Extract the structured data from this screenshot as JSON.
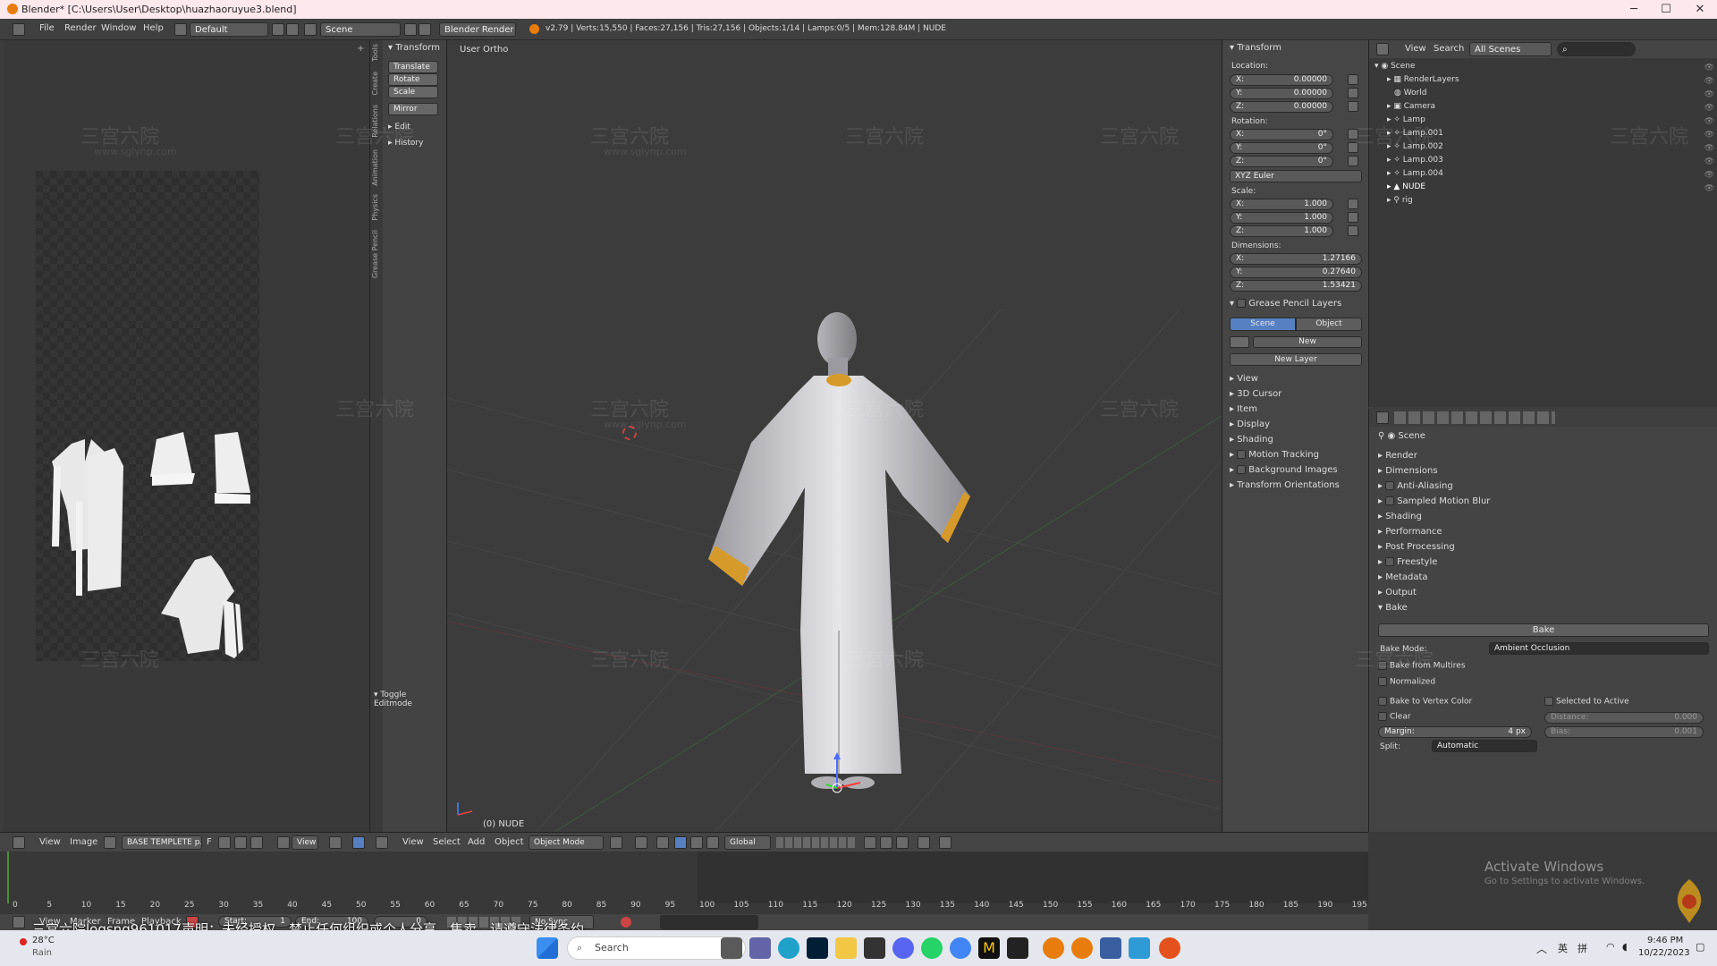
{
  "window": {
    "title": "Blender* [C:\\Users\\User\\Desktop\\huazhaoruyue3.blend]",
    "minimize": "─",
    "maximize": "☐",
    "close": "✕"
  },
  "menu": {
    "file": "File",
    "render": "Render",
    "window": "Window",
    "help": "Help",
    "layout": "Default",
    "scene": "Scene",
    "engine": "Blender Render",
    "stats": "v2.79 | Verts:15,550 | Faces:27,156 | Tris:27,156 | Objects:1/14 | Lamps:0/5 | Mem:128.84M | NUDE"
  },
  "toolshelf": {
    "header": "Transform",
    "translate": "Translate",
    "rotate": "Rotate",
    "scale": "Scale",
    "mirror": "Mirror",
    "edit": "Edit",
    "history": "History",
    "toggle": "Toggle Editmode",
    "tabs": [
      "Tools",
      "Create",
      "Relations",
      "Animation",
      "Physics",
      "Grease Pencil"
    ]
  },
  "viewport": {
    "label": "User Ortho",
    "object_label": "(0) NUDE",
    "watermark_cn": "三宫六院",
    "watermark_url": "www.sglynp.com"
  },
  "npanel": {
    "transform": "Transform",
    "location": "Location:",
    "rotation": "Rotation:",
    "scale": "Scale:",
    "dimensions": "Dimensions:",
    "loc": [
      {
        "k": "X:",
        "v": "0.00000"
      },
      {
        "k": "Y:",
        "v": "0.00000"
      },
      {
        "k": "Z:",
        "v": "0.00000"
      }
    ],
    "rot": [
      {
        "k": "X:",
        "v": "0°"
      },
      {
        "k": "Y:",
        "v": "0°"
      },
      {
        "k": "Z:",
        "v": "0°"
      }
    ],
    "euler": "XYZ Euler",
    "scl": [
      {
        "k": "X:",
        "v": "1.000"
      },
      {
        "k": "Y:",
        "v": "1.000"
      },
      {
        "k": "Z:",
        "v": "1.000"
      }
    ],
    "dim": [
      {
        "k": "X:",
        "v": "1.27166"
      },
      {
        "k": "Y:",
        "v": "0.27640"
      },
      {
        "k": "Z:",
        "v": "1.53421"
      }
    ],
    "gp_layers": "Grease Pencil Layers",
    "gp_scene": "Scene",
    "gp_object": "Object",
    "gp_new": "New",
    "gp_newlayer": "New Layer",
    "sections": [
      "View",
      "3D Cursor",
      "Item",
      "Display",
      "Shading",
      "Motion Tracking",
      "Background Images",
      "Transform Orientations"
    ]
  },
  "outliner": {
    "view": "View",
    "search": "Search",
    "filter": "All Scenes",
    "items": [
      {
        "name": "Scene",
        "indent": 0
      },
      {
        "name": "RenderLayers",
        "indent": 1
      },
      {
        "name": "World",
        "indent": 1
      },
      {
        "name": "Camera",
        "indent": 1
      },
      {
        "name": "Lamp",
        "indent": 1
      },
      {
        "name": "Lamp.001",
        "indent": 1
      },
      {
        "name": "Lamp.002",
        "indent": 1
      },
      {
        "name": "Lamp.003",
        "indent": 1
      },
      {
        "name": "Lamp.004",
        "indent": 1
      },
      {
        "name": "NUDE",
        "indent": 1
      },
      {
        "name": "rig",
        "indent": 1
      }
    ]
  },
  "props": {
    "scene": "Scene",
    "sections": [
      "Render",
      "Dimensions",
      "Anti-Aliasing",
      "Sampled Motion Blur",
      "Shading",
      "Performance",
      "Post Processing",
      "Freestyle",
      "Metadata",
      "Output",
      "Bake"
    ],
    "bake_btn": "Bake",
    "bake_mode_label": "Bake Mode:",
    "bake_mode": "Ambient Occlusion",
    "from_multires": "Bake from Multires",
    "normalized": "Normalized",
    "vertex_color": "Bake to Vertex Color",
    "selected_active": "Selected to Active",
    "clear": "Clear",
    "distance": "Distance:",
    "distance_v": "0.000",
    "margin": "Margin:",
    "margin_v": "4 px",
    "bias": "Bias:",
    "bias_v": "0.001",
    "split": "Split:",
    "split_v": "Automatic"
  },
  "vheader": {
    "view": "View",
    "image": "Image",
    "image_name": "BASE TEMPLETE p...",
    "f": "F",
    "view2": "View",
    "view3": "View",
    "select": "Select",
    "add": "Add",
    "object": "Object",
    "mode": "Object Mode",
    "orientation": "Global"
  },
  "timeline": {
    "ticks": [
      "0",
      "5",
      "10",
      "15",
      "20",
      "25",
      "30",
      "35",
      "40",
      "45",
      "50",
      "55",
      "60",
      "65",
      "70",
      "75",
      "80",
      "85",
      "90",
      "95",
      "100",
      "105",
      "110",
      "115",
      "120",
      "125",
      "130",
      "135",
      "140",
      "145",
      "150",
      "155",
      "160",
      "165",
      "170",
      "175",
      "180",
      "185",
      "190",
      "195"
    ],
    "view": "View",
    "marker": "Marker",
    "frame": "Frame",
    "playback": "Playback",
    "start": "Start:",
    "start_v": "1",
    "end": "End:",
    "end_v": "100",
    "cur": "0",
    "nosync": "No Sync"
  },
  "subtitle": "三宫六院logsng961017声明：未经授权，禁止任何组织或个人分享、售卖，请遵守法律条约",
  "activate": {
    "title": "Activate Windows",
    "sub": "Go to Settings to activate Windows."
  },
  "taskbar": {
    "temp": "28°C",
    "weather": "Rain",
    "search": "Search",
    "time": "9:46 PM",
    "date": "10/22/2023",
    "lang1": "英",
    "lang2": "拼"
  },
  "colors": {
    "accent": "#5680c2",
    "orange": "#e87d0d",
    "titlebar": "#fde8ec"
  }
}
